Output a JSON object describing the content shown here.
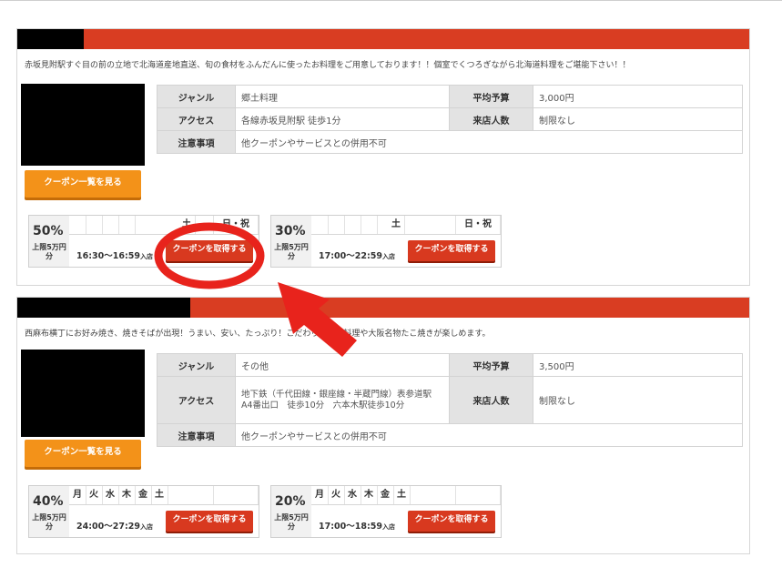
{
  "listings": [
    {
      "description": "赤坂見附駅すぐ目の前の立地で北海道産地直送、旬の食材をふんだんに使ったお料理をご用意しております！！個室でくつろぎながら北海道料理をご堪能下さい！！",
      "labels": {
        "genre": "ジャンル",
        "access": "アクセス",
        "notes": "注意事項",
        "budget": "平均予算",
        "party": "来店人数"
      },
      "genre": "郷土料理",
      "access": "各線赤坂見附駅 徒歩1分",
      "notes": "他クーポンやサービスとの併用不可",
      "budget": "3,000円",
      "party": "制限なし",
      "coupon_list_label": "クーポン一覧を見る",
      "coupons": [
        {
          "percent": "50%",
          "limit": "上限5万円分",
          "days": [
            "",
            "",
            "",
            "",
            "土"
          ],
          "holiday": "日・祝",
          "time": "16:30〜16:59",
          "time_suffix": "入店",
          "button": "クーポンを取得する"
        },
        {
          "percent": "30%",
          "limit": "上限5万円分",
          "days": [
            "",
            "",
            "",
            "",
            "土"
          ],
          "holiday": "日・祝",
          "time": "17:00〜22:59",
          "time_suffix": "入店",
          "button": "クーポンを取得する"
        }
      ]
    },
    {
      "description": "西麻布横丁にお好み焼き、焼きそばが出現！うまい、安い、たっぷり！こだわりの鉄板料理や大阪名物たこ焼きが楽しめます。",
      "labels": {
        "genre": "ジャンル",
        "access": "アクセス",
        "notes": "注意事項",
        "budget": "平均予算",
        "party": "来店人数"
      },
      "genre": "その他",
      "access": "地下鉄（千代田線・銀座線・半蔵門線）表参道駅　A4番出口　徒歩10分　六本木駅徒歩10分",
      "notes": "他クーポンやサービスとの併用不可",
      "budget": "3,500円",
      "party": "制限なし",
      "coupon_list_label": "クーポン一覧を見る",
      "coupons": [
        {
          "percent": "40%",
          "limit": "上限5万円分",
          "days": [
            "月",
            "火",
            "水",
            "木",
            "金",
            "土"
          ],
          "holiday": "",
          "time": "24:00〜27:29",
          "time_suffix": "入店",
          "button": "クーポンを取得する"
        },
        {
          "percent": "20%",
          "limit": "上限5万円分",
          "days": [
            "月",
            "火",
            "水",
            "木",
            "金",
            "土"
          ],
          "holiday": "",
          "time": "17:00〜18:59",
          "time_suffix": "入店",
          "button": "クーポンを取得する"
        }
      ]
    }
  ],
  "annotation": {
    "color": "#e8231c"
  }
}
